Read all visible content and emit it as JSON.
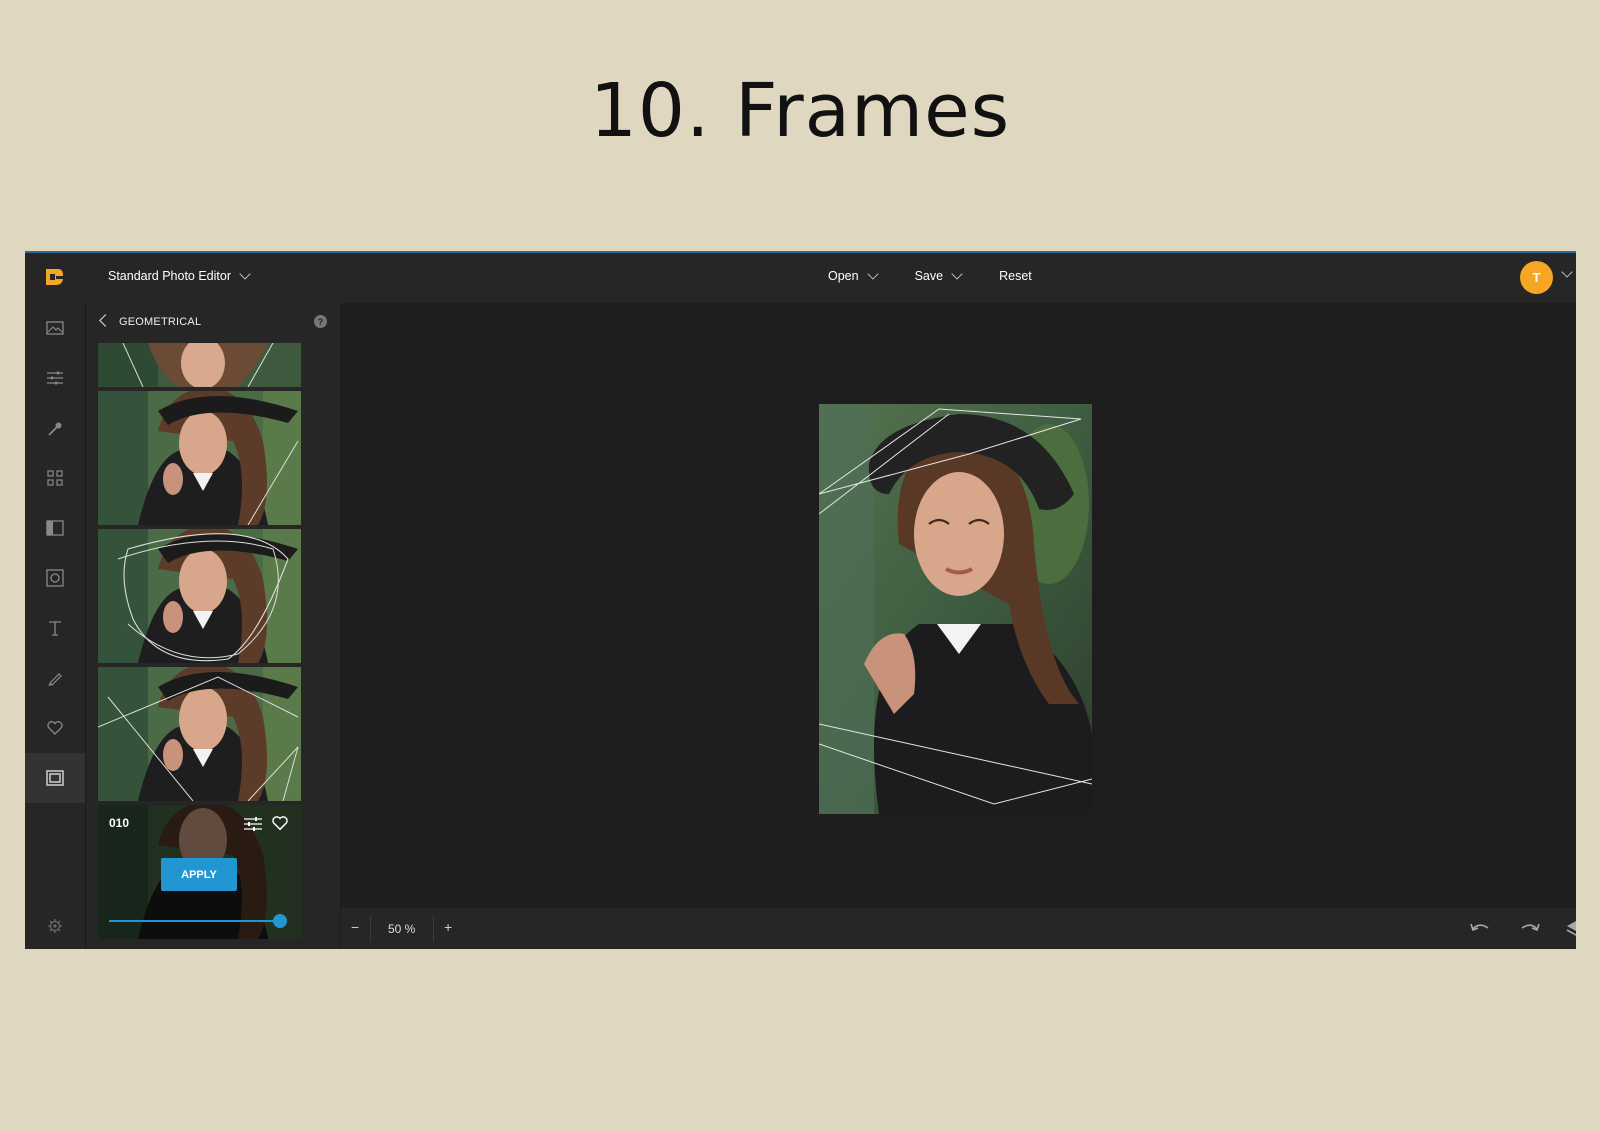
{
  "slide": {
    "title": "10. Frames"
  },
  "app": {
    "editor_name": "Standard Photo Editor",
    "menu": {
      "open": "Open",
      "save": "Save",
      "reset": "Reset"
    },
    "user_initial": "T",
    "accent_color": "#2196d3",
    "logo_color": "#f5a623"
  },
  "sidebar_icons": [
    "image-icon",
    "adjust-icon",
    "magic-wand-icon",
    "grid-icon",
    "overlay-icon",
    "frame-icon",
    "text-icon",
    "brush-icon",
    "heart-icon",
    "frames-icon",
    "settings-icon"
  ],
  "panel": {
    "title": "GEOMETRICAL",
    "help": "?",
    "selected_frame": {
      "number": "010",
      "apply_label": "APPLY",
      "intensity": 1.0
    }
  },
  "zoom": {
    "value": "50 %",
    "minus": "−",
    "plus": "+"
  }
}
